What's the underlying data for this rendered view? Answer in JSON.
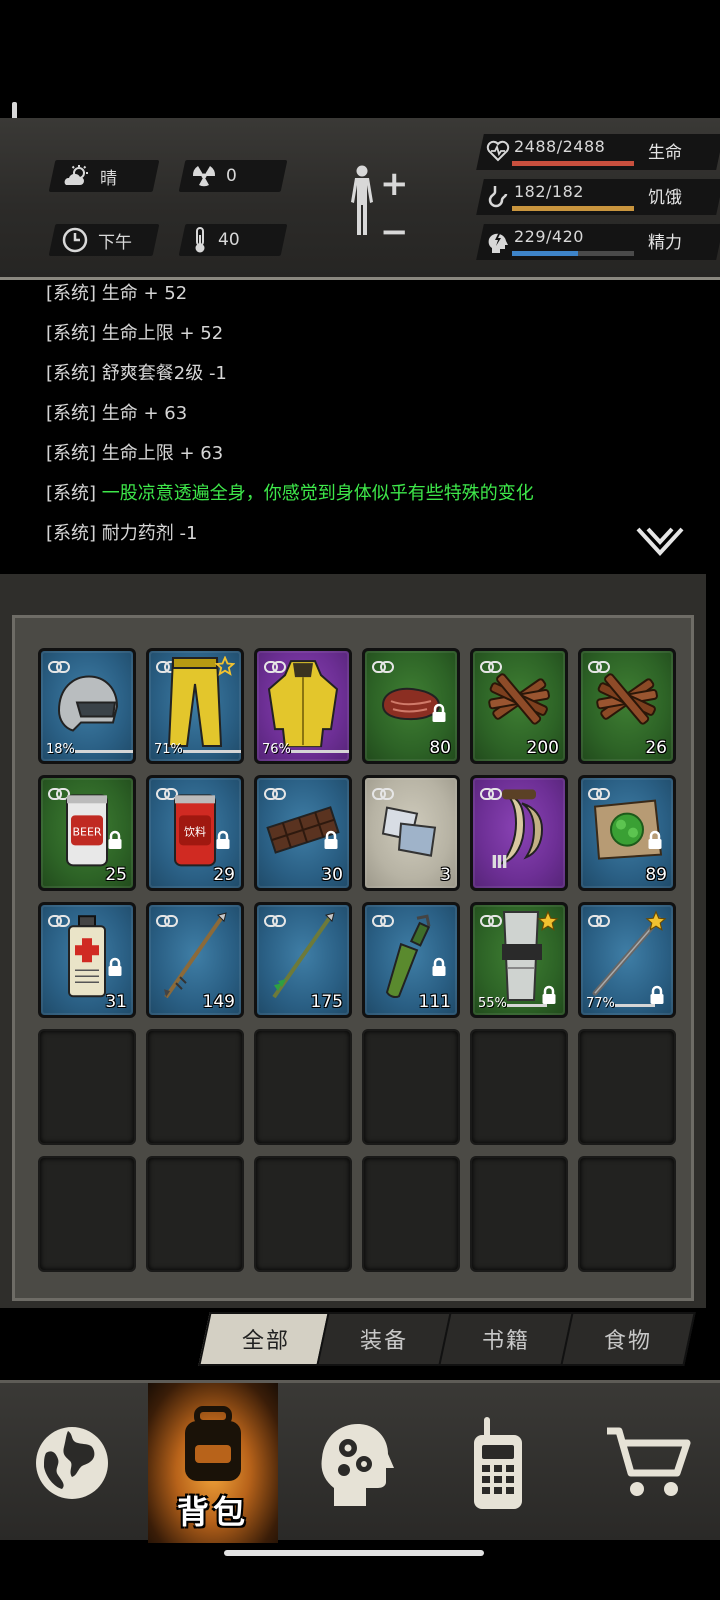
{
  "status": {
    "weather": "晴",
    "radiation": "0",
    "time_of_day": "下午",
    "temperature": "40",
    "health": {
      "value": "2488/2488",
      "label": "生命",
      "fraction": 1.0,
      "color": "#c9503e"
    },
    "hunger": {
      "value": "182/182",
      "label": "饥饿",
      "fraction": 1.0,
      "color": "#c9953e"
    },
    "stamina": {
      "value": "229/420",
      "label": "精力",
      "fraction": 0.545,
      "color": "#3e84c9"
    },
    "body_plus": "+",
    "body_minus": "−"
  },
  "log": [
    {
      "text": "[系统] 生命 + 52",
      "green": false
    },
    {
      "text": "[系统] 生命上限 + 52",
      "green": false
    },
    {
      "text": "[系统] 舒爽套餐2级 -1",
      "green": false
    },
    {
      "text": "[系统] 生命 + 63",
      "green": false
    },
    {
      "text": "[系统] 生命上限 + 63",
      "green": false
    },
    {
      "prefix": "[系统] ",
      "text": "一股凉意透遍全身，你感觉到身体似乎有些特殊的变化",
      "green": true
    },
    {
      "text": "[系统] 耐力药剂 -1",
      "green": false
    }
  ],
  "inventory": [
    {
      "icon": "helmet-icon",
      "rarity": "blue",
      "durability": "18%",
      "durability_fraction": 0.18,
      "locked": false,
      "starred": false
    },
    {
      "icon": "yellow-pants-icon",
      "rarity": "blue",
      "durability": "71%",
      "durability_fraction": 0.71,
      "locked": false,
      "starred": true,
      "star_outline": true
    },
    {
      "icon": "hazmat-jacket-icon",
      "rarity": "purple",
      "durability": "76%",
      "durability_fraction": 0.76,
      "locked": false,
      "starred": false
    },
    {
      "icon": "raw-meat-icon",
      "rarity": "green",
      "quantity": "80",
      "locked": true
    },
    {
      "icon": "wood-sticks-icon",
      "rarity": "green",
      "quantity": "200",
      "locked": false
    },
    {
      "icon": "wood-sticks-icon",
      "rarity": "green",
      "quantity": "26",
      "locked": false
    },
    {
      "icon": "beer-can-icon",
      "rarity": "green",
      "quantity": "25",
      "locked": true,
      "can_text": "BEER"
    },
    {
      "icon": "soda-can-icon",
      "rarity": "blue",
      "quantity": "29",
      "locked": true,
      "can_text": "饮料"
    },
    {
      "icon": "chocolate-icon",
      "rarity": "blue",
      "quantity": "30",
      "locked": true
    },
    {
      "icon": "cloth-scraps-icon",
      "rarity": "grey",
      "quantity": "3",
      "locked": false
    },
    {
      "icon": "fang-icon",
      "rarity": "purple",
      "tier": "Ⅲ",
      "locked": false
    },
    {
      "icon": "herb-map-icon",
      "rarity": "blue",
      "quantity": "89",
      "locked": true
    },
    {
      "icon": "medicine-spray-icon",
      "rarity": "blue",
      "quantity": "31",
      "locked": true
    },
    {
      "icon": "arrow-icon",
      "rarity": "blue",
      "quantity": "149",
      "locked": false
    },
    {
      "icon": "green-arrow-icon",
      "rarity": "blue",
      "quantity": "175",
      "locked": false
    },
    {
      "icon": "molotov-icon",
      "rarity": "blue",
      "quantity": "111",
      "locked": true
    },
    {
      "icon": "arm-guard-icon",
      "rarity": "green",
      "durability": "55%",
      "durability_fraction": 0.55,
      "locked": true,
      "starred": true
    },
    {
      "icon": "rod-icon",
      "rarity": "blue",
      "durability": "77%",
      "durability_fraction": 0.77,
      "locked": true,
      "starred": true
    }
  ],
  "tabs": [
    "全部",
    "装备",
    "书籍",
    "食物"
  ],
  "nav": {
    "active_label": "背包"
  },
  "colors": {
    "star": "#f2c230",
    "log_green": "#3ee84a"
  }
}
